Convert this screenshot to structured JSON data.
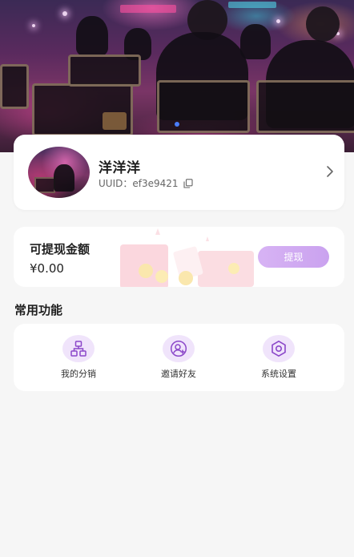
{
  "profile": {
    "username": "洋洋洋",
    "uuid_label": "UUID：",
    "uuid_value": "ef3e9421"
  },
  "withdraw": {
    "title": "可提现金额",
    "amount": "¥0.00",
    "button_label": "提现"
  },
  "functions": {
    "section_title": "常用功能",
    "items": [
      {
        "label": "我的分销",
        "icon": "distribution-icon"
      },
      {
        "label": "邀请好友",
        "icon": "invite-friend-icon"
      },
      {
        "label": "系统设置",
        "icon": "settings-hexagon-icon"
      }
    ]
  },
  "colors": {
    "accent": "#8b47c9",
    "accent_light": "#f0e4fb",
    "button_bg": "#d3aef3",
    "page_bg": "#f6f6f6"
  }
}
